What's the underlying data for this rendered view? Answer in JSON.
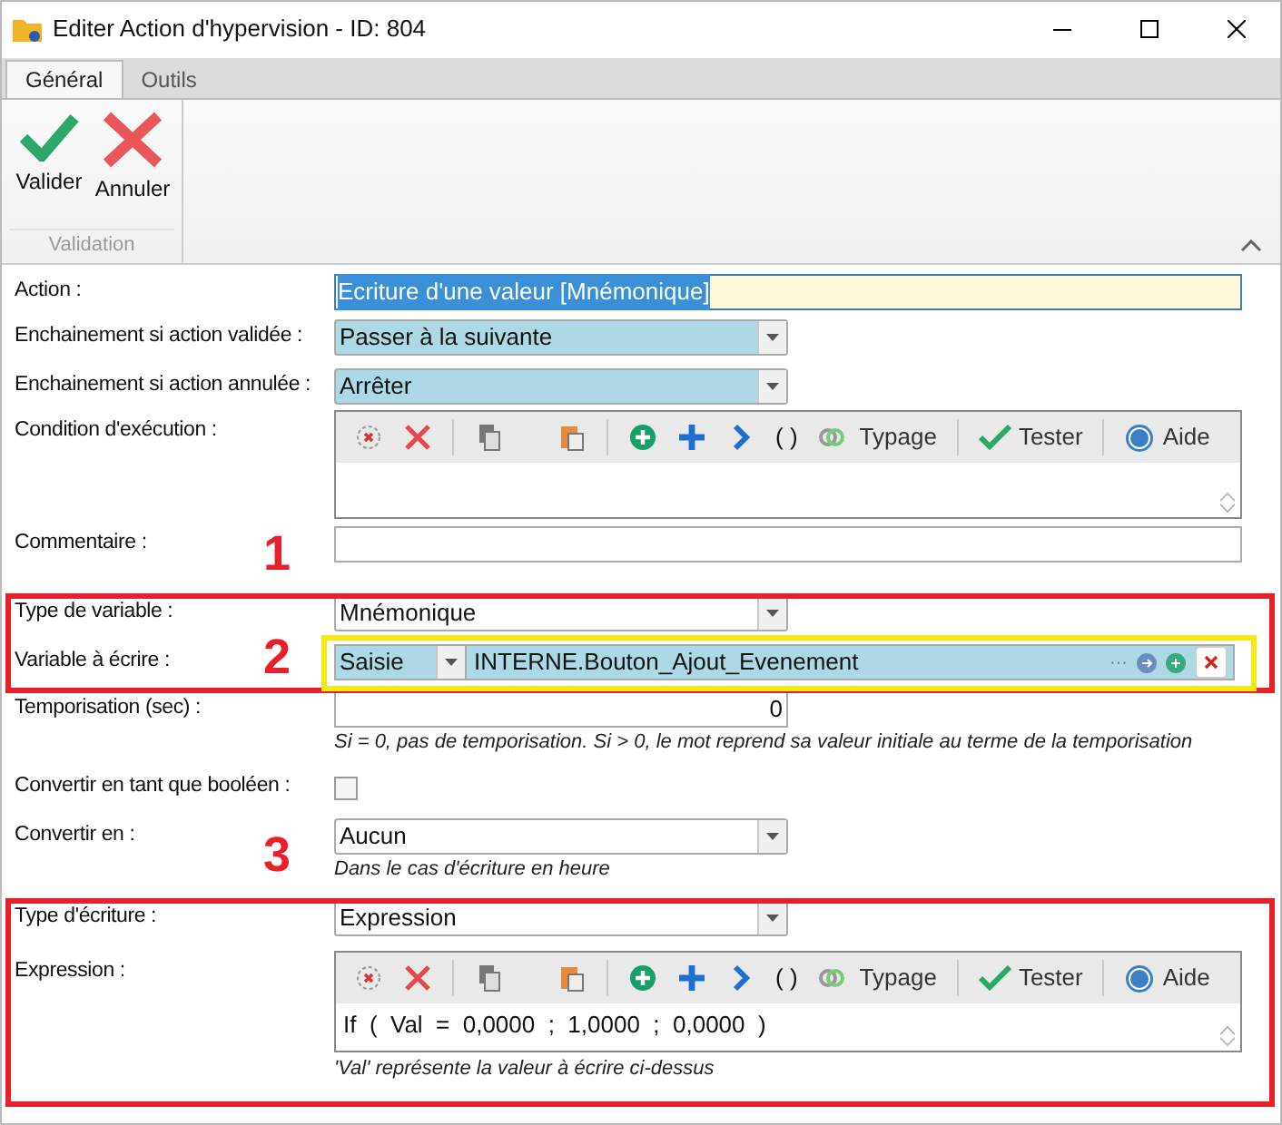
{
  "window": {
    "title": "Editer Action d'hypervision - ID: 804"
  },
  "tabs": [
    {
      "label": "Général",
      "selected": true
    },
    {
      "label": "Outils",
      "selected": false
    }
  ],
  "ribbon": {
    "buttons": [
      {
        "kind": "ok",
        "label": "Valider"
      },
      {
        "kind": "cancel",
        "label": "Annuler"
      }
    ],
    "group_label": "Validation"
  },
  "form": {
    "rows": [
      {
        "kind": "text",
        "label": "Action :",
        "value": "Ecriture d'une valeur [Mnémonique]",
        "highlighted": true
      },
      {
        "kind": "dropdown",
        "label": "Enchainement si action validée :",
        "value": "Passer à la suivante",
        "highlighted": true
      },
      {
        "kind": "dropdown",
        "label": "Enchainement si action annulée :",
        "value": "Arrêter",
        "highlighted": true
      },
      {
        "kind": "editor",
        "label": "Condition d'exécution :",
        "toolbar": {
          "parens": "( )",
          "typage": "Typage",
          "test": "Tester",
          "help": "Aide"
        }
      },
      {
        "kind": "text",
        "label": "Commentaire :",
        "value": "",
        "highlighted": false
      },
      {
        "kind": "dropdown",
        "label": "Type de variable :",
        "value": "Mnémonique",
        "highlighted": false
      },
      {
        "kind": "variable",
        "label": "Variable à écrire :",
        "mode": "Saisie",
        "value": "INTERNE.Bouton_Ajout_Evenement",
        "more": "···"
      },
      {
        "kind": "number",
        "label": "Temporisation (sec) :",
        "value": "0",
        "hint": "Si = 0, pas de temporisation. Si > 0, le mot reprend sa valeur initiale au terme de la temporisation"
      },
      {
        "kind": "checkbox",
        "label": "Convertir en tant que booléen :",
        "checked": false
      },
      {
        "kind": "dropdown",
        "label": "Convertir en :",
        "value": "Aucun",
        "highlighted": false,
        "hint": "Dans le cas d'écriture en heure"
      },
      {
        "kind": "dropdown",
        "label": "Type d'écriture :",
        "value": "Expression",
        "highlighted": false
      },
      {
        "kind": "editor",
        "label": "Expression :",
        "toolbar": {
          "parens": "( )",
          "typage": "Typage",
          "test": "Tester",
          "help": "Aide"
        },
        "value": "If  (  Val  =  0,0000  ;  1,0000  ;  0,0000  )",
        "hint": "'Val' représente la valeur à écrire ci-dessus"
      }
    ]
  },
  "annotations": [
    {
      "number": "1",
      "color": "#e8202a"
    },
    {
      "number": "2",
      "color": "#e8202a"
    },
    {
      "number": "3",
      "color": "#e8202a"
    }
  ],
  "frames": [
    {
      "color": "#e8202a"
    },
    {
      "color": "#e8202a"
    }
  ],
  "highlight_box": {
    "color": "#f5e816"
  }
}
